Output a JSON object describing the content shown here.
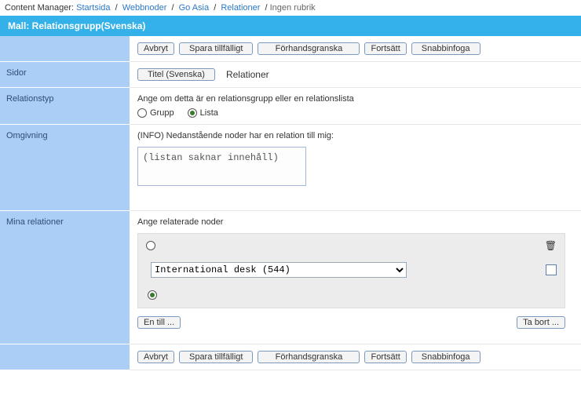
{
  "breadcrumb": {
    "app": "Content Manager:",
    "items": [
      "Startsida",
      "Webbnoder",
      "Go Asia",
      "Relationer"
    ],
    "current": "Ingen rubrik"
  },
  "titlebar": "Mall: Relationsgrupp(Svenska)",
  "buttons": {
    "cancel": "Avbryt",
    "save_temp": "Spara tillfälligt",
    "preview": "Förhandsgranska",
    "continue": "Fortsätt",
    "quick_insert": "Snabbinfoga",
    "title_tab": "Titel (Svenska)",
    "relations_tab": "Relationer",
    "one_more": "En till ...",
    "remove": "Ta bort ..."
  },
  "labels": {
    "pages": "Sidor",
    "reltype": "Relationstyp",
    "environment": "Omgivning",
    "my_relations": "Mina relationer"
  },
  "reltype": {
    "prompt": "Ange om detta är en relationsgrupp eller en relationslista",
    "group": "Grupp",
    "list": "Lista",
    "selected": "list"
  },
  "environment": {
    "info": "(INFO) Nedanstående noder har en relation till mig:",
    "empty_text": "(listan saknar innehåll)"
  },
  "my_relations": {
    "prompt": "Ange relaterade noder",
    "selected_option": "International desk (544)",
    "row_selected_index": 1
  }
}
